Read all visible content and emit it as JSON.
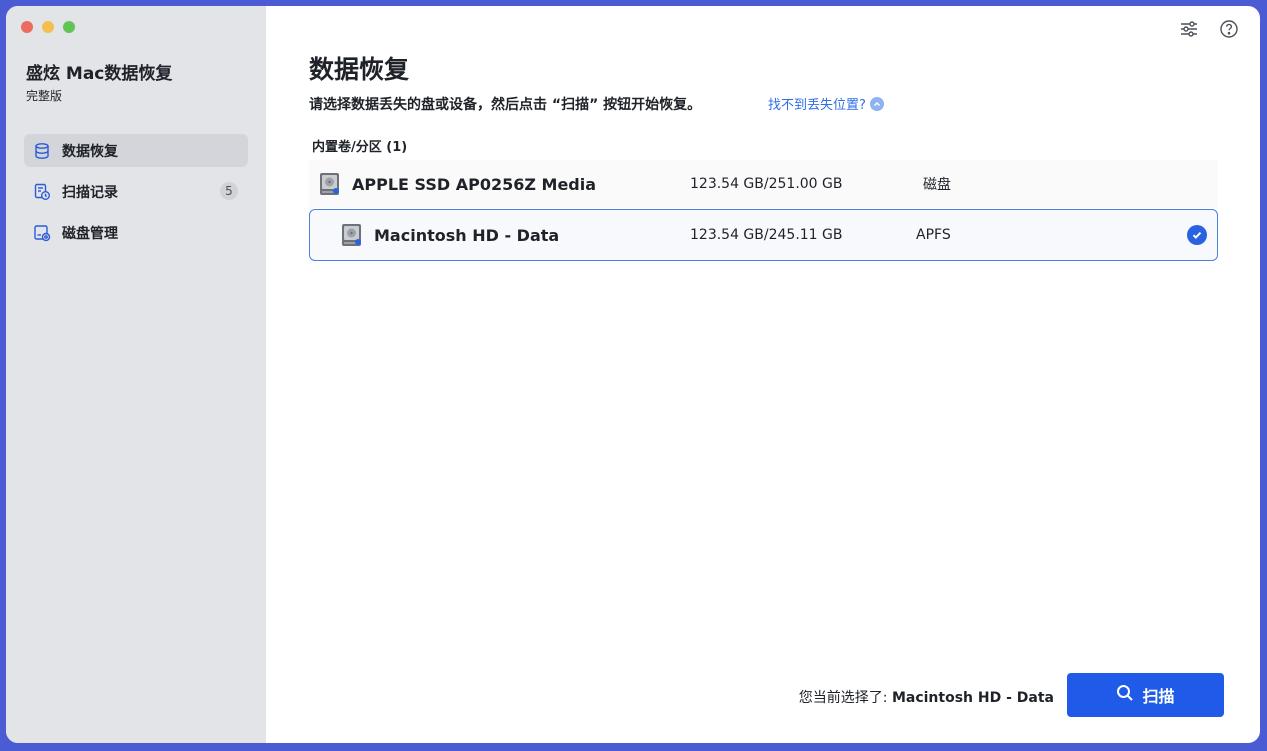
{
  "app": {
    "title": "盛炫 Mac数据恢复",
    "edition": "完整版"
  },
  "sidebar": {
    "items": [
      {
        "label": "数据恢复",
        "icon": "database-icon",
        "active": true
      },
      {
        "label": "扫描记录",
        "icon": "history-icon",
        "badge": "5"
      },
      {
        "label": "磁盘管理",
        "icon": "disk-settings-icon"
      }
    ]
  },
  "toolbar": {
    "settings_icon": "sliders-icon",
    "help_icon": "help-icon"
  },
  "main": {
    "title": "数据恢复",
    "description": "请选择数据丢失的盘或设备，然后点击 “扫描” 按钮开始恢复。",
    "help_link": "找不到丢失位置?",
    "section_label": "内置卷/分区 (1)",
    "drives": [
      {
        "name": "APPLE SSD AP0256Z Media",
        "size": "123.54 GB/251.00 GB",
        "type": "磁盘",
        "selected": false
      },
      {
        "name": "Macintosh HD - Data",
        "size": "123.54 GB/245.11 GB",
        "type": "APFS",
        "selected": true
      }
    ]
  },
  "footer": {
    "selected_prefix": "您当前选择了: ",
    "selected_value": "Macintosh HD - Data",
    "scan_label": "扫描"
  },
  "colors": {
    "accent": "#1f5ae8",
    "sidebar_bg": "#e3e4e8"
  }
}
